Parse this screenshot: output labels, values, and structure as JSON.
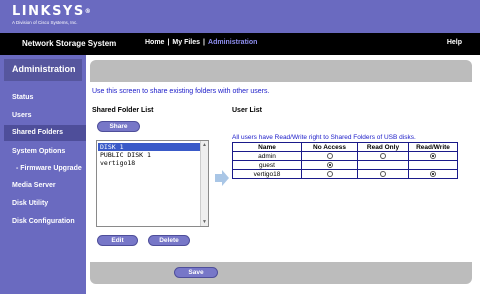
{
  "header": {
    "logo": "LINKSYS",
    "logo_mark": "®",
    "logo_tagline": "A Division of Cisco Systems, Inc."
  },
  "topnav": {
    "system_name": "Network Storage System",
    "links": [
      "Home",
      "My Files",
      "Administration"
    ],
    "separator": "|",
    "help": "Help"
  },
  "sidebar": {
    "title": "Administration",
    "items": [
      "Status",
      "Users",
      "Shared Folders",
      "System Options",
      "- Firmware Upgrade",
      "Media Server",
      "Disk Utility",
      "Disk Configuration"
    ],
    "active": "Shared Folders"
  },
  "main": {
    "intro": "Use this screen to share existing folders with other users.",
    "shared_folder_list_heading": "Shared Folder List",
    "share_button": "Share",
    "folders": [
      "DISK 1",
      "PUBLIC DISK 1",
      "vertigo18"
    ],
    "selected_folder": "DISK 1",
    "edit_button": "Edit",
    "delete_button": "Delete",
    "user_list_heading": "User List",
    "note": "All users have Read/Write right to Shared Folders of USB disks.",
    "table_headers": [
      "Name",
      "No Access",
      "Read Only",
      "Read/Write"
    ],
    "users": [
      {
        "name": "admin",
        "access": "Read/Write"
      },
      {
        "name": "guest",
        "access": "No Access"
      },
      {
        "name": "vertigo18",
        "access": "Read/Write"
      }
    ],
    "save_button": "Save"
  },
  "colors": {
    "brand_purple": "#6a6ac0",
    "nav_black": "#000000",
    "active_link": "#8f8ff0",
    "info_text": "#1a1ac8",
    "panel_gray": "#bcbcbc"
  }
}
